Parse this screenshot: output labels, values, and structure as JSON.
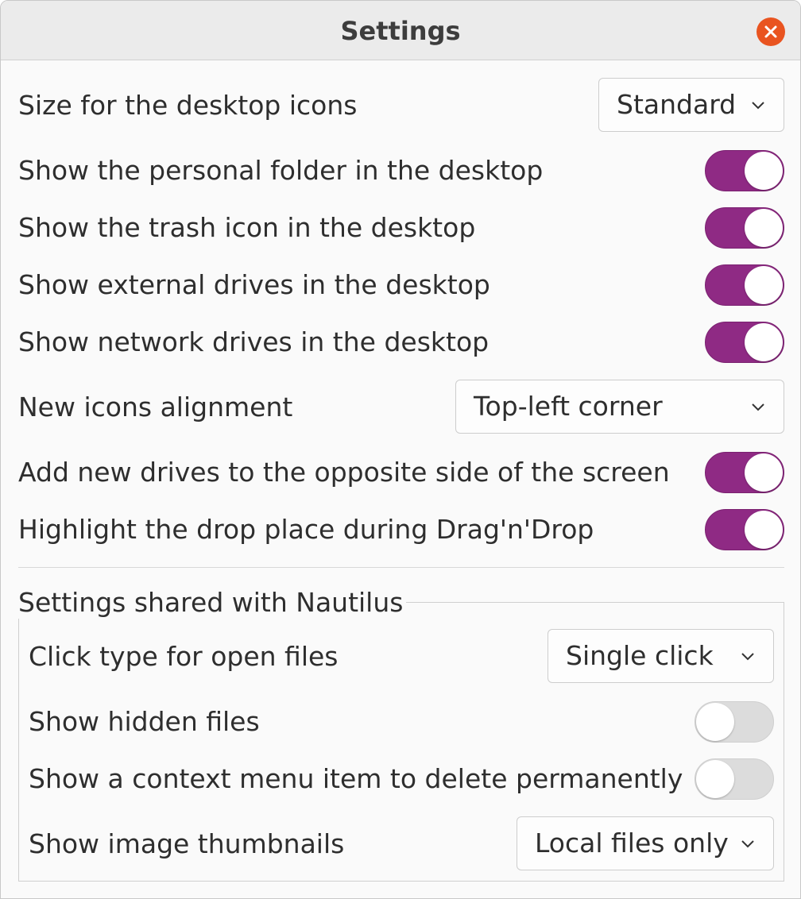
{
  "window": {
    "title": "Settings",
    "close_icon": "close-icon",
    "accent_color": "#e95420",
    "toggle_on_color": "#8f2a84"
  },
  "desktop": {
    "icon_size": {
      "label": "Size for the desktop icons",
      "value": "Standard"
    },
    "show_personal_folder": {
      "label": "Show the personal folder in the desktop",
      "on": true
    },
    "show_trash": {
      "label": "Show the trash icon in the desktop",
      "on": true
    },
    "show_external_drives": {
      "label": "Show external drives in the desktop",
      "on": true
    },
    "show_network_drives": {
      "label": "Show network drives in the desktop",
      "on": true
    },
    "alignment": {
      "label": "New icons alignment",
      "value": "Top-left corner"
    },
    "drives_opposite_side": {
      "label": "Add new drives to the opposite side of the screen",
      "on": true
    },
    "highlight_drop": {
      "label": "Highlight the drop place during Drag'n'Drop",
      "on": true
    }
  },
  "nautilus": {
    "frame_label": "Settings shared with Nautilus",
    "click_type": {
      "label": "Click type for open files",
      "value": "Single click"
    },
    "show_hidden": {
      "label": "Show hidden files",
      "on": false
    },
    "delete_permanently": {
      "label": "Show a context menu item to delete permanently",
      "on": false
    },
    "thumbnails": {
      "label": "Show image thumbnails",
      "value": "Local files only"
    }
  }
}
